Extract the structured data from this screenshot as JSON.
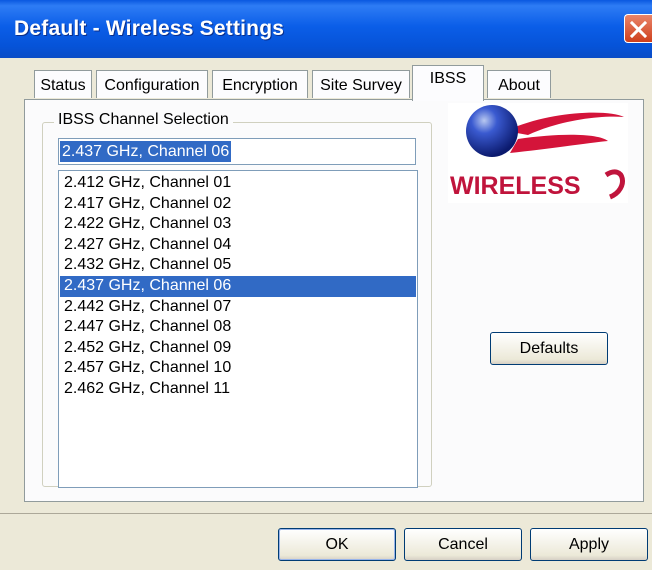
{
  "window": {
    "title": "Default - Wireless Settings"
  },
  "tabs": [
    {
      "label": "Status"
    },
    {
      "label": "Configuration"
    },
    {
      "label": "Encryption"
    },
    {
      "label": "Site Survey"
    },
    {
      "label": "IBSS"
    },
    {
      "label": "About"
    }
  ],
  "active_tab": "IBSS",
  "ibss": {
    "group_label": "IBSS Channel Selection",
    "selected_value": "2.437 GHz, Channel 06",
    "channels": [
      "2.412 GHz, Channel 01",
      "2.417 GHz, Channel 02",
      "2.422 GHz, Channel 03",
      "2.427 GHz, Channel 04",
      "2.432 GHz, Channel 05",
      "2.437 GHz, Channel 06",
      "2.442 GHz, Channel 07",
      "2.447 GHz, Channel 08",
      "2.452 GHz, Channel 09",
      "2.457 GHz, Channel 10",
      "2.462 GHz, Channel 11"
    ],
    "selected_index": 5
  },
  "logo": {
    "text": "WIRELESS",
    "icon": "wireless-globe-logo"
  },
  "buttons": {
    "defaults": "Defaults",
    "ok": "OK",
    "cancel": "Cancel",
    "apply": "Apply"
  },
  "colors": {
    "titlebar": "#0a58e0",
    "selection": "#316ac5",
    "logo_text": "#c0143c",
    "logo_swoosh": "#d4143a"
  }
}
